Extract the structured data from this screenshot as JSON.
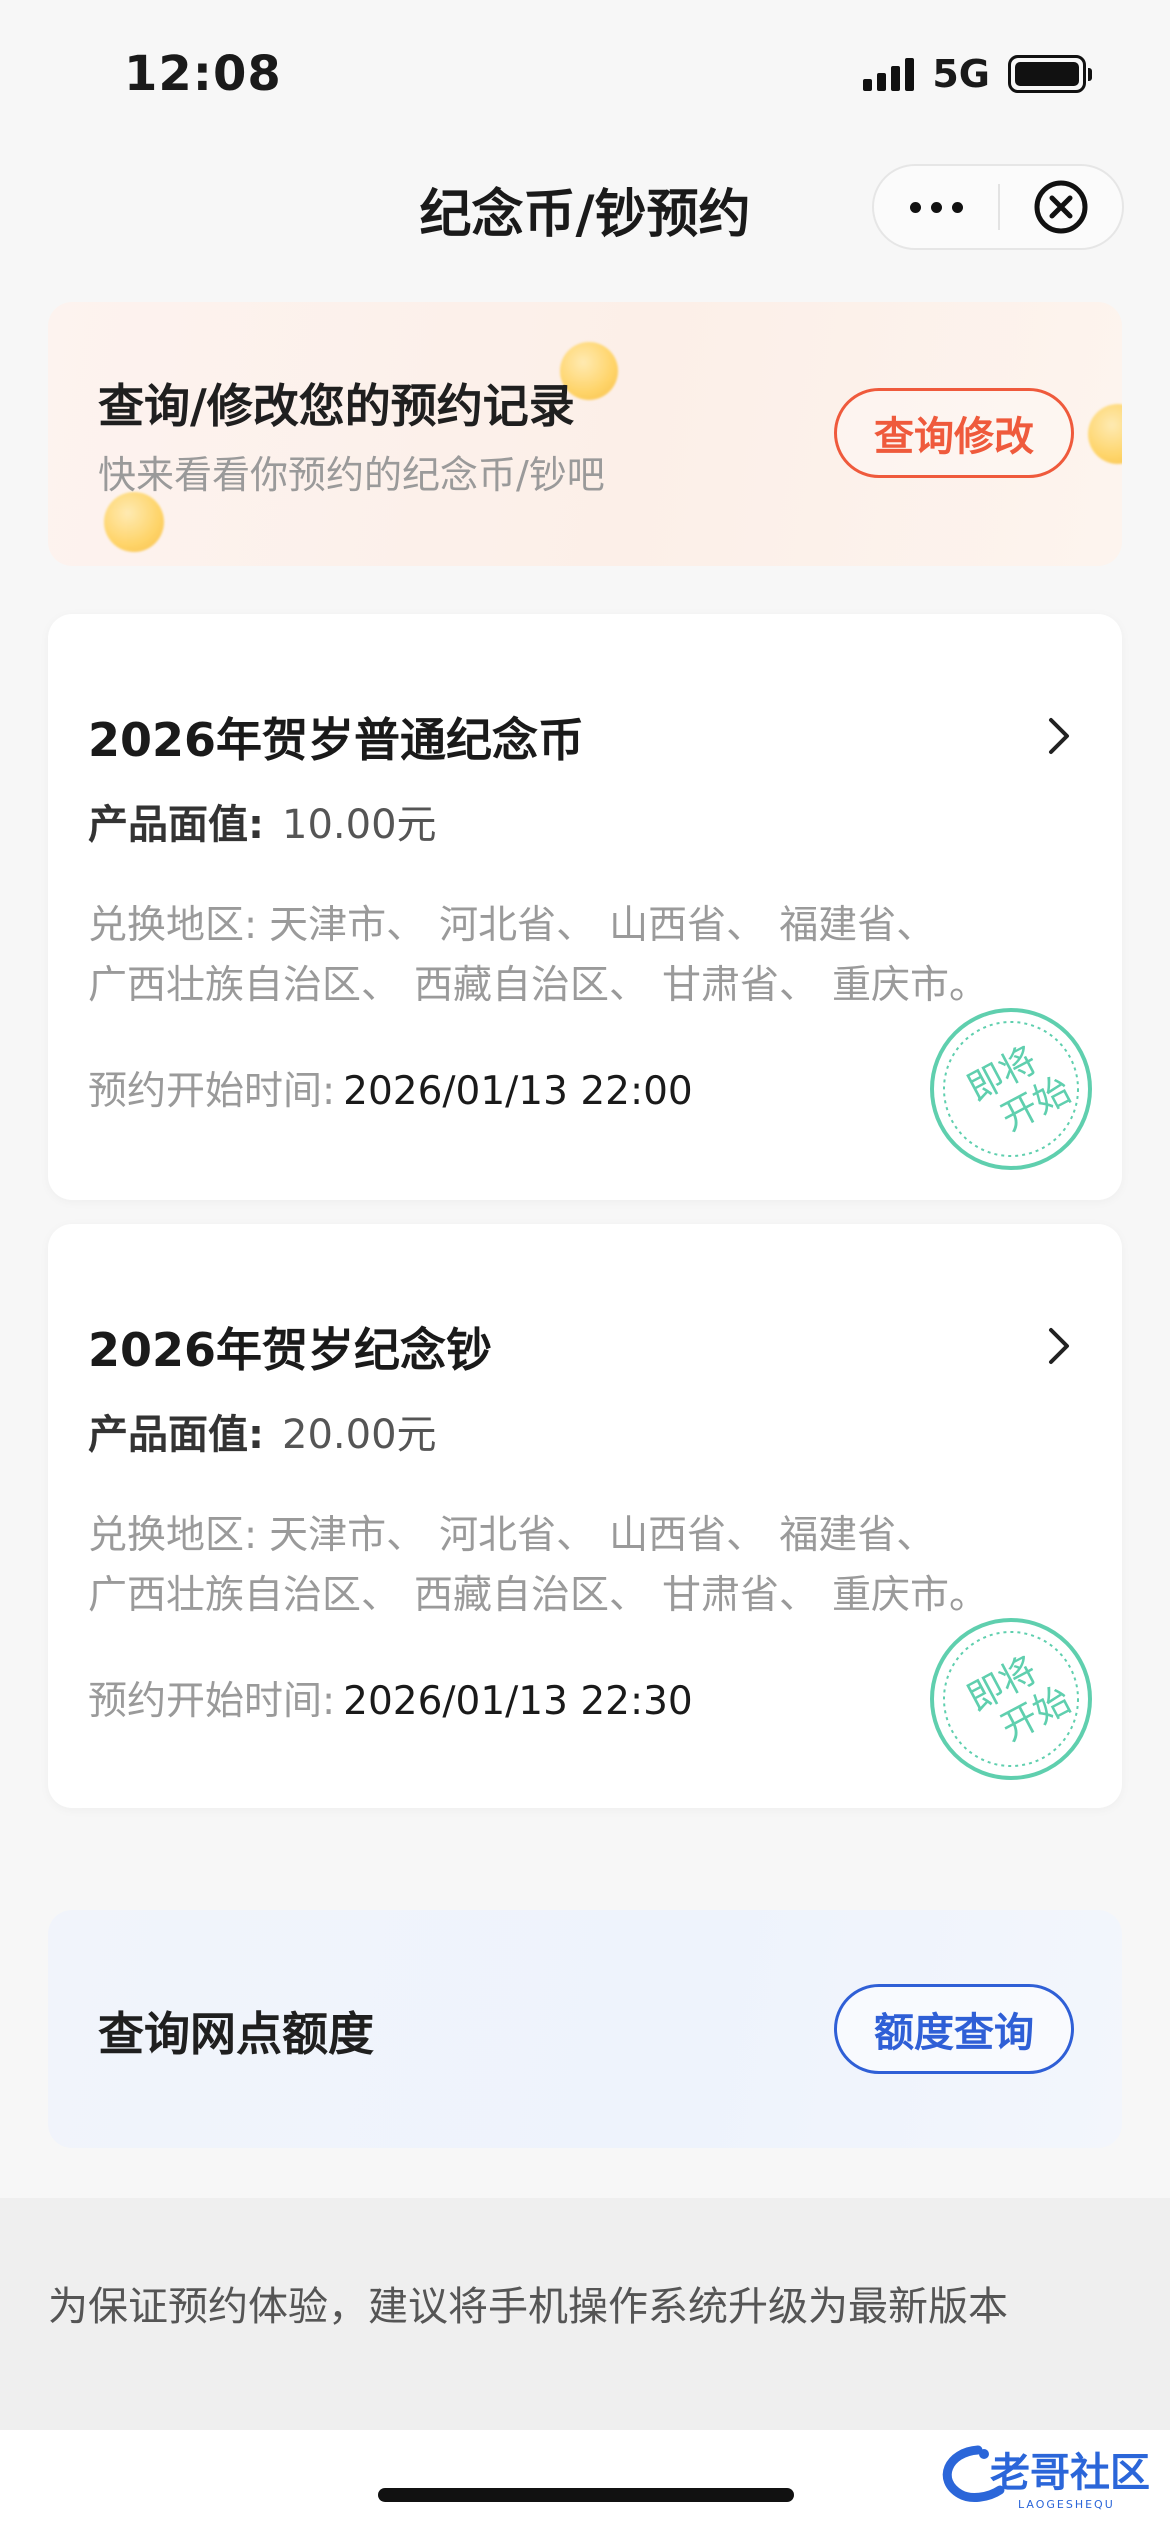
{
  "status_bar": {
    "time": "12:08",
    "network": "5G"
  },
  "nav": {
    "title": "纪念币/钞预约"
  },
  "banner": {
    "title": "查询/修改您的预约记录",
    "subtitle": "快来看看你预约的纪念币/钞吧",
    "button_label": "查询修改"
  },
  "products": [
    {
      "title": "2026年贺岁普通纪念币",
      "face_label": "产品面值:",
      "face_value": "10.00元",
      "region_label": "兑换地区:",
      "regions": [
        "天津市、",
        "河北省、",
        "山西省、",
        "福建省、",
        "广西壮族自治区、",
        "西藏自治区、",
        "甘肃省、",
        "重庆市。"
      ],
      "start_label": "预约开始时间:",
      "start_time": "2026/01/13 22:00",
      "stamp_line1": "即将",
      "stamp_line2": "开始"
    },
    {
      "title": "2026年贺岁纪念钞",
      "face_label": "产品面值:",
      "face_value": "20.00元",
      "region_label": "兑换地区:",
      "regions": [
        "天津市、",
        "河北省、",
        "山西省、",
        "福建省、",
        "广西壮族自治区、",
        "西藏自治区、",
        "甘肃省、",
        "重庆市。"
      ],
      "start_label": "预约开始时间:",
      "start_time": "2026/01/13 22:30",
      "stamp_line1": "即将",
      "stamp_line2": "开始"
    }
  ],
  "quota": {
    "title": "查询网点额度",
    "button_label": "额度查询"
  },
  "notice": "为保证预约体验，建议将手机操作系统升级为最新版本",
  "watermark": {
    "text": "老哥社区",
    "subtext": "LAOGESHEQU"
  },
  "colors": {
    "accent_red": "#ef5a3c",
    "accent_blue": "#2f5fd6",
    "stamp_green": "#5fcfae"
  }
}
